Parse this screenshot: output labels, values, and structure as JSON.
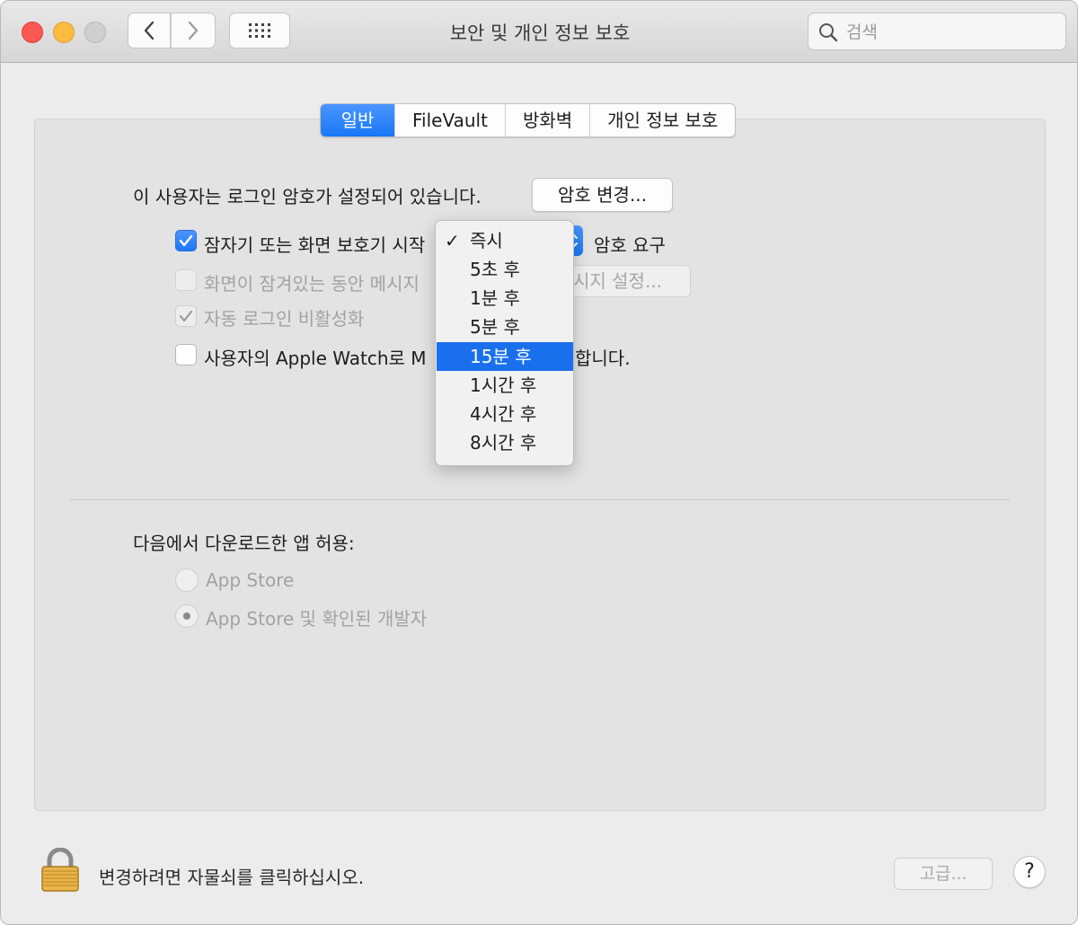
{
  "window": {
    "title": "보안 및 개인 정보 보호",
    "search_placeholder": "검색"
  },
  "tabs": [
    {
      "label": "일반",
      "active": true
    },
    {
      "label": "FileVault",
      "active": false
    },
    {
      "label": "방화벽",
      "active": false
    },
    {
      "label": "개인 정보 보호",
      "active": false
    }
  ],
  "general": {
    "password_set_text": "이 사용자는 로그인 암호가 설정되어 있습니다.",
    "change_password_button": "암호 변경...",
    "require_password": {
      "label": "잠자기 또는 화면 보호기 시작",
      "checked": true,
      "suffix": "암호 요구"
    },
    "lock_message": {
      "label": "화면이 잠겨있는 동안 메시지",
      "checked": false,
      "enabled": false,
      "button": "시지 설정..."
    },
    "disable_auto_login": {
      "label": "자동 로그인 비활성화",
      "checked": true,
      "enabled": false
    },
    "apple_watch": {
      "label_left": "사용자의 Apple Watch로 M",
      "label_right": "합니다.",
      "checked": false
    }
  },
  "delay_menu": {
    "selected": "즉시",
    "highlighted": "15분 후",
    "check_glyph": "✓",
    "options": [
      "즉시",
      "5초 후",
      "1분 후",
      "5분 후",
      "15분 후",
      "1시간 후",
      "4시간 후",
      "8시간 후"
    ]
  },
  "downloads": {
    "heading": "다음에서 다운로드한 앱 허용:",
    "options": [
      {
        "label": "App Store",
        "selected": false
      },
      {
        "label": "App Store 및 확인된 개발자",
        "selected": true
      }
    ]
  },
  "footer": {
    "lock_text": "변경하려면 자물쇠를 클릭하십시오.",
    "advanced_button": "고급...",
    "help_button": "?"
  },
  "colors": {
    "accent": "#1877f6",
    "menu_highlight": "#1a70ec",
    "close": "#fc5753",
    "minimize": "#fdbc40"
  }
}
